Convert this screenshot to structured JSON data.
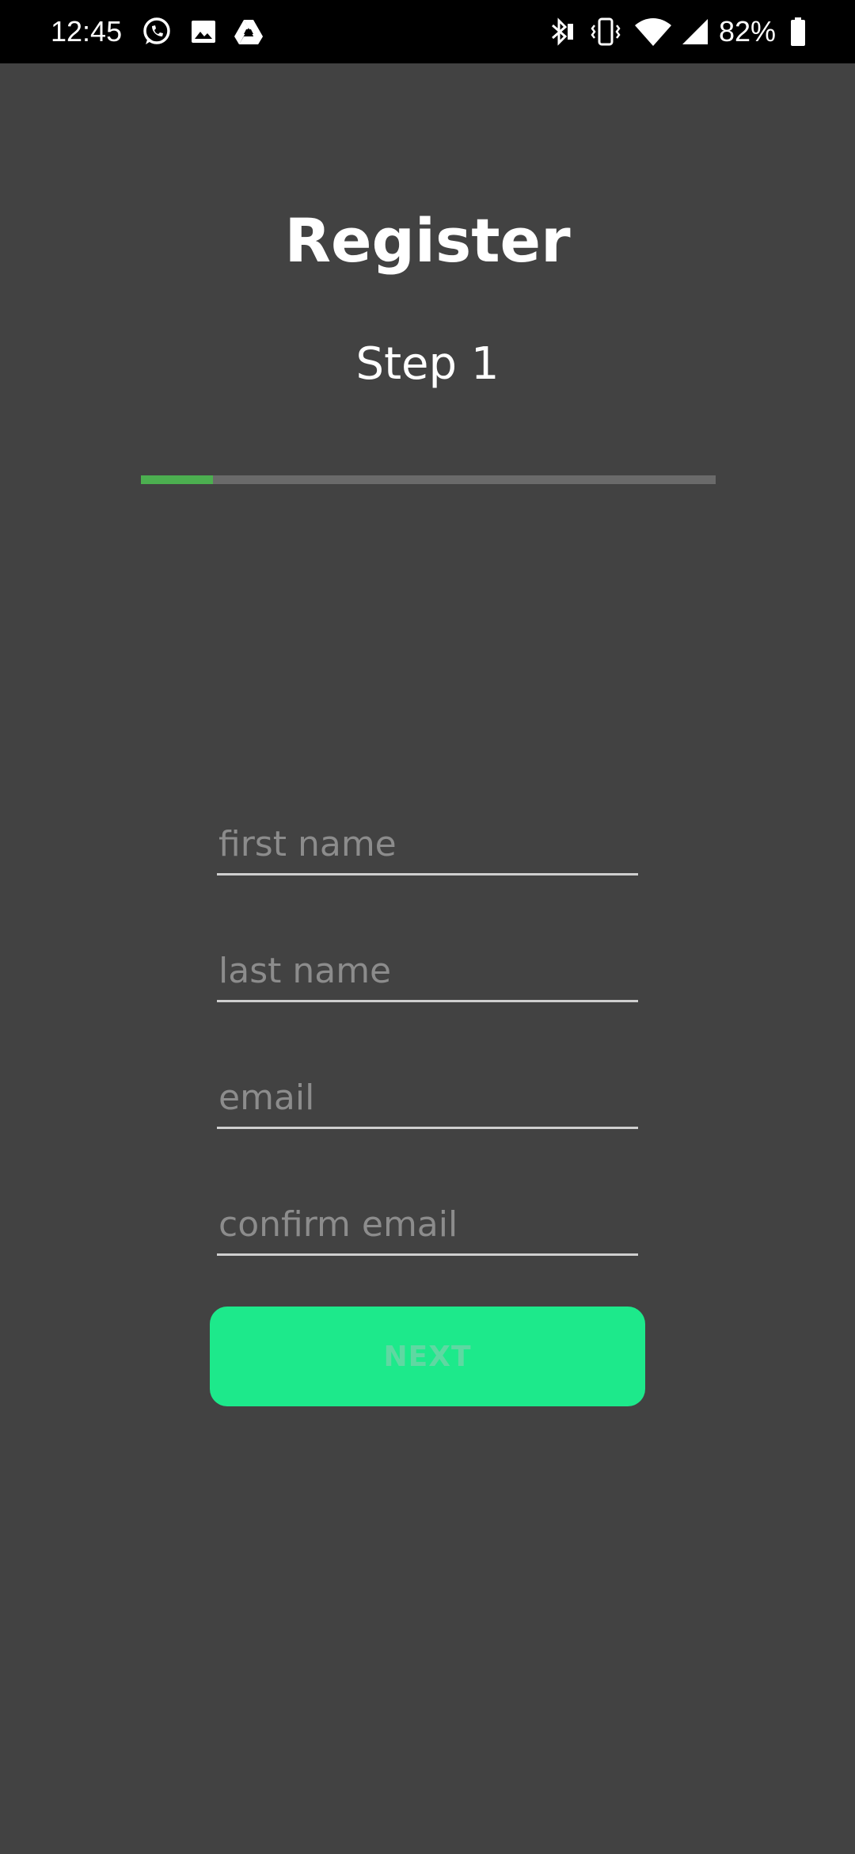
{
  "status_bar": {
    "time": "12:45",
    "left_icons": [
      "whatsapp-icon",
      "image-icon",
      "drive-icon"
    ],
    "right_icons": [
      "bluetooth-icon",
      "vibrate-icon",
      "wifi-icon",
      "signal-icon",
      "battery-icon"
    ],
    "battery_percent": "82%"
  },
  "header": {
    "title": "Register",
    "step": "Step 1"
  },
  "progress": {
    "fraction": 0.125,
    "fill_color": "#4caf50",
    "track_color": "#6a6a6a"
  },
  "form": {
    "first_name_placeholder": "first name",
    "last_name_placeholder": "last name",
    "email_placeholder": "email",
    "confirm_email_placeholder": "confirm email",
    "first_name_value": "",
    "last_name_value": "",
    "email_value": "",
    "confirm_email_value": ""
  },
  "actions": {
    "next_label": "NEXT",
    "next_color": "#1de98b"
  },
  "colors": {
    "background": "#424242",
    "status_bar": "#000000",
    "text": "#ffffff"
  }
}
